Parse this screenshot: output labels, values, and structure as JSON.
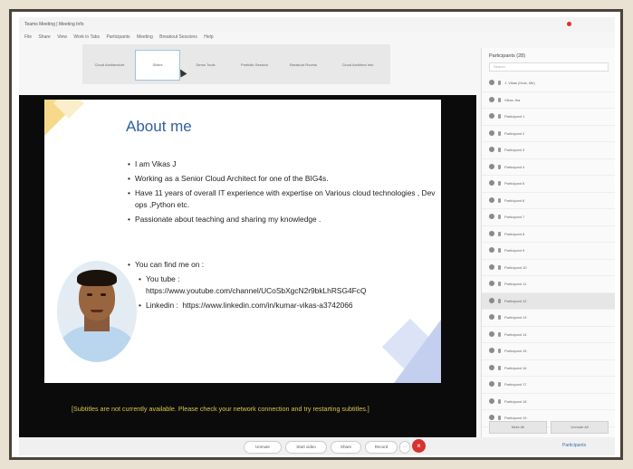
{
  "window": {
    "title": "Teams Meeting | Meeting Info"
  },
  "menubar": [
    "File",
    "Share",
    "View",
    "Work in Tabs",
    "Participants",
    "Meeting",
    "Breakout Sessions",
    "Help"
  ],
  "tabs": [
    {
      "label": "Cloud Architecture"
    },
    {
      "label": "Slides"
    },
    {
      "label": "Demo Tools"
    },
    {
      "label": "Portfolio Session"
    },
    {
      "label": "Breakout Rooms"
    },
    {
      "label": "Cloud Architect Info"
    }
  ],
  "slide": {
    "title": "About me",
    "bullets": [
      "I am Vikas J",
      "Working as a Senior Cloud Architect for one of the BIG4s.",
      "Have 11 years of overall IT experience with expertise on Various cloud technologies , Dev ops ,Python etc.",
      "Passionate about teaching and sharing my knowledge ."
    ],
    "find_heading": "You can find me on :",
    "youtube_label": "You tube :",
    "youtube_url": "https://www.youtube.com/channel/UCoSbXgcN2r9bkLhRSG4FcQ",
    "linkedin_label": "Linkedin :",
    "linkedin_url": "https://www.linkedin.com/in/kumar-vikas-a3742066"
  },
  "subtitle_notice": "[Subtitles are not currently available. Please check your network connection and try restarting subtitles.]",
  "controls": [
    "Unmute",
    "Start video",
    "Share",
    "Record"
  ],
  "participants_button": "Participants",
  "panel": {
    "header": "Participants (28)",
    "search_placeholder": "Search",
    "participants": [
      {
        "name": "J. Vikas (Host, Me)"
      },
      {
        "name": "Vikas Jha"
      },
      {
        "name": "Participant 1"
      },
      {
        "name": "Participant 2"
      },
      {
        "name": "Participant 3"
      },
      {
        "name": "Participant 4"
      },
      {
        "name": "Participant 5"
      },
      {
        "name": "Participant 6"
      },
      {
        "name": "Participant 7"
      },
      {
        "name": "Participant 8"
      },
      {
        "name": "Participant 9"
      },
      {
        "name": "Participant 10"
      },
      {
        "name": "Participant 11"
      },
      {
        "name": "Participant 12"
      },
      {
        "name": "Participant 13"
      },
      {
        "name": "Participant 14"
      },
      {
        "name": "Participant 15"
      },
      {
        "name": "Participant 16"
      },
      {
        "name": "Participant 17"
      },
      {
        "name": "Participant 18"
      },
      {
        "name": "Participant 19"
      }
    ],
    "mute_all": "Mute All",
    "unmute_all": "Unmute All"
  }
}
